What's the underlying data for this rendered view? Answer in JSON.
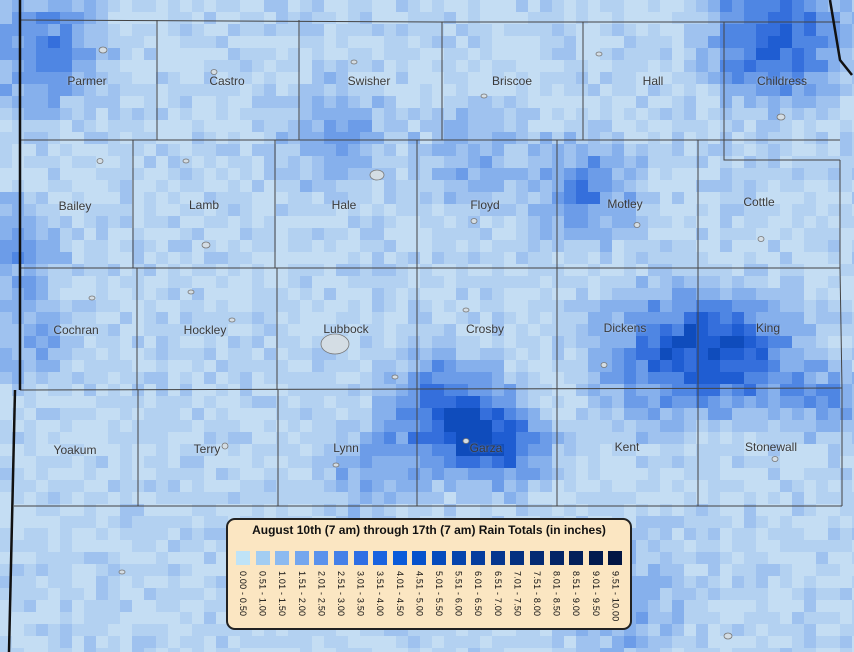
{
  "map": {
    "counties": [
      {
        "name": "Parmer"
      },
      {
        "name": "Castro"
      },
      {
        "name": "Swisher"
      },
      {
        "name": "Briscoe"
      },
      {
        "name": "Hall"
      },
      {
        "name": "Childress"
      },
      {
        "name": "Bailey"
      },
      {
        "name": "Lamb"
      },
      {
        "name": "Hale"
      },
      {
        "name": "Floyd"
      },
      {
        "name": "Motley"
      },
      {
        "name": "Cottle"
      },
      {
        "name": "Cochran"
      },
      {
        "name": "Hockley"
      },
      {
        "name": "Lubbock"
      },
      {
        "name": "Crosby"
      },
      {
        "name": "Dickens"
      },
      {
        "name": "King"
      },
      {
        "name": "Yoakum"
      },
      {
        "name": "Terry"
      },
      {
        "name": "Lynn"
      },
      {
        "name": "Garza"
      },
      {
        "name": "Kent"
      },
      {
        "name": "Stonewall"
      }
    ]
  },
  "legend": {
    "title": "August 10th (7 am) through 17th (7 am)  Rain Totals (in inches)",
    "bins": [
      {
        "label": "0.00 - 0.50",
        "color": "#bfe3f7"
      },
      {
        "label": "0.51 - 1.00",
        "color": "#a3cdf2"
      },
      {
        "label": "1.01 - 1.50",
        "color": "#8cbaf0"
      },
      {
        "label": "1.51 - 2.00",
        "color": "#74a6ee"
      },
      {
        "label": "2.01 - 2.50",
        "color": "#5b92ec"
      },
      {
        "label": "2.51 - 3.00",
        "color": "#4580e8"
      },
      {
        "label": "3.01 - 3.50",
        "color": "#2f6ee4"
      },
      {
        "label": "3.51 - 4.00",
        "color": "#1a63e0"
      },
      {
        "label": "4.01 - 4.50",
        "color": "#0a5bda"
      },
      {
        "label": "4.51 - 5.00",
        "color": "#0652cc"
      },
      {
        "label": "5.01 - 5.50",
        "color": "#054bbd"
      },
      {
        "label": "5.51 - 6.00",
        "color": "#0544ad"
      },
      {
        "label": "6.01 - 6.50",
        "color": "#053d9e"
      },
      {
        "label": "6.51 - 7.00",
        "color": "#05378f"
      },
      {
        "label": "7.01 - 7.50",
        "color": "#043181"
      },
      {
        "label": "7.51 - 8.00",
        "color": "#042b74"
      },
      {
        "label": "8.01 - 8.50",
        "color": "#032567"
      },
      {
        "label": "8.51 - 9.00",
        "color": "#03205b"
      },
      {
        "label": "9.01 - 9.50",
        "color": "#021b4f"
      },
      {
        "label": "9.51 - 10.00",
        "color": "#021644"
      }
    ]
  }
}
